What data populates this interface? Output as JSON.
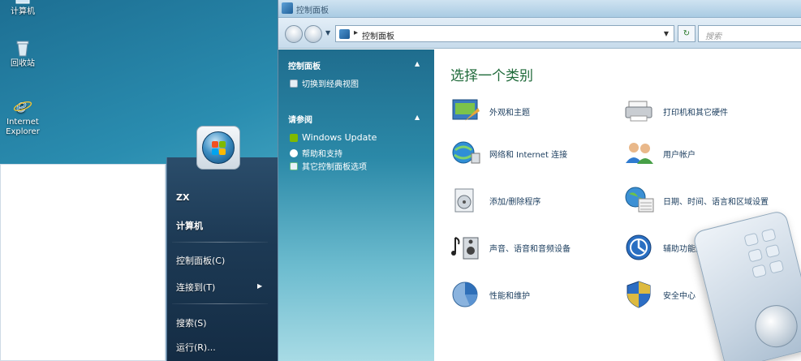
{
  "desktop": {
    "icons": [
      {
        "label": "计算机",
        "icon": "computer-icon"
      },
      {
        "label": "回收站",
        "icon": "recycle-bin-icon"
      },
      {
        "label_line1": "Internet",
        "label_line2": "Explorer",
        "icon": "ie-icon"
      }
    ]
  },
  "start_menu": {
    "user": "ZX",
    "items": [
      "计算机",
      "控制面板(C)",
      "连接到(T)",
      "搜索(S)",
      "运行(R)..."
    ]
  },
  "window": {
    "title": "控制面板",
    "address": "控制面板",
    "search_placeholder": "搜索"
  },
  "left_pane": {
    "section1_title": "控制面板",
    "section1_links": [
      "切换到经典视图"
    ],
    "section2_title": "请参阅",
    "section2_links": [
      "Windows Update",
      "帮助和支持",
      "其它控制面板选项"
    ]
  },
  "content": {
    "heading": "选择一个类别",
    "categories": [
      {
        "label": "外观和主题",
        "icon": "appearance-icon"
      },
      {
        "label": "打印机和其它硬件",
        "icon": "printer-icon"
      },
      {
        "label": "网络和 Internet 连接",
        "icon": "network-icon"
      },
      {
        "label": "用户帐户",
        "icon": "user-accounts-icon"
      },
      {
        "label": "添加/删除程序",
        "icon": "add-remove-programs-icon"
      },
      {
        "label": "日期、时间、语言和区域设置",
        "icon": "date-time-globe-icon"
      },
      {
        "label": "声音、语音和音频设备",
        "icon": "sound-icon"
      },
      {
        "label": "辅助功能选项",
        "icon": "accessibility-icon"
      },
      {
        "label": "性能和维护",
        "icon": "performance-icon"
      },
      {
        "label": "安全中心",
        "icon": "security-shield-icon"
      }
    ]
  },
  "colors": {
    "desktop": "#2a8db0",
    "start_panel": "#1d3a55",
    "heading_green": "#1f6a3a",
    "link_blue": "#1b3d5e"
  }
}
